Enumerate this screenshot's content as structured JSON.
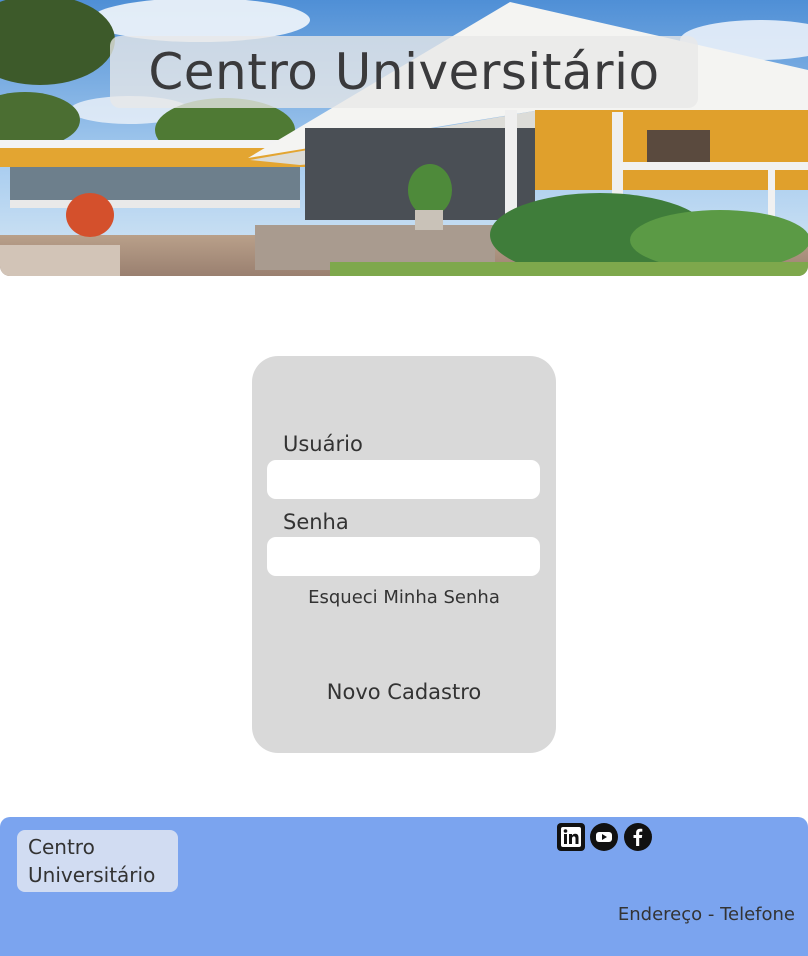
{
  "hero": {
    "title": "Centro Universitário"
  },
  "login": {
    "username_label": "Usuário",
    "username_value": "",
    "password_label": "Senha",
    "password_value": "",
    "forgot_password": "Esqueci Minha Senha",
    "new_signup": "Novo Cadastro"
  },
  "footer": {
    "brand_line1": "Centro",
    "brand_line2": "Universitário",
    "social": [
      {
        "icon": "linkedin-icon"
      },
      {
        "icon": "youtube-icon"
      },
      {
        "icon": "facebook-icon"
      }
    ],
    "contact": "Endereço - Telefone"
  },
  "colors": {
    "footer_bg": "#7ba4ef",
    "card_bg": "#d9d9d9",
    "text": "#333333"
  }
}
